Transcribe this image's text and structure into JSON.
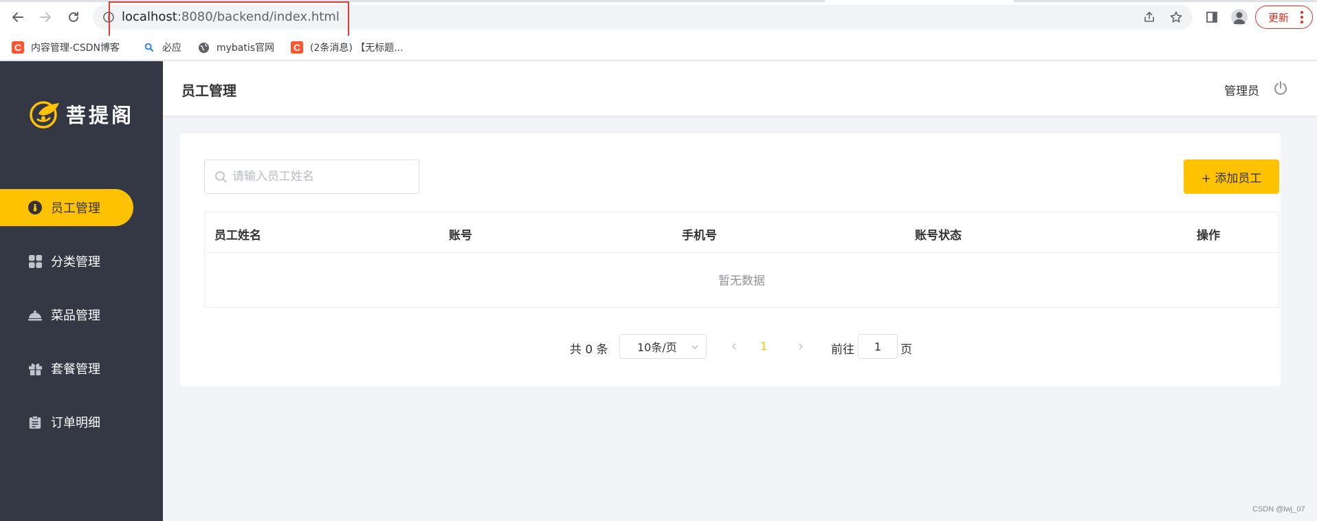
{
  "browser": {
    "url_host": "localhost",
    "url_rest": ":8080/backend/index.html",
    "update_label": "更新",
    "bookmarks": [
      {
        "label": "内容管理-CSDN博客",
        "icon": "csdn-icon"
      },
      {
        "label": "必应",
        "icon": "bing-search-icon"
      },
      {
        "label": "mybatis官网",
        "icon": "globe-icon"
      },
      {
        "label": "(2条消息) 【无标题...",
        "icon": "csdn-icon"
      }
    ],
    "csdn_glyph": "C"
  },
  "sidebar": {
    "logo_text": "菩提阁",
    "items": [
      {
        "label": "员工管理",
        "icon": "employee-icon",
        "active": true
      },
      {
        "label": "分类管理",
        "icon": "category-grid-icon",
        "active": false
      },
      {
        "label": "菜品管理",
        "icon": "dish-cloche-icon",
        "active": false
      },
      {
        "label": "套餐管理",
        "icon": "gift-icon",
        "active": false
      },
      {
        "label": "订单明细",
        "icon": "clipboard-icon",
        "active": false
      }
    ]
  },
  "header": {
    "title": "员工管理",
    "user": "管理员"
  },
  "toolbar": {
    "search_placeholder": "请输入员工姓名",
    "add_label": "+ 添加员工"
  },
  "table": {
    "columns": [
      "员工姓名",
      "账号",
      "手机号",
      "账号状态",
      "操作"
    ],
    "empty_text": "暂无数据"
  },
  "pagination": {
    "total_text": "共 0 条",
    "page_size": "10条/页",
    "current_page": "1",
    "goto_label": "前往",
    "goto_value": "1",
    "goto_suffix": "页"
  },
  "colors": {
    "accent": "#ffc200",
    "sidebar_bg": "#343744",
    "highlight_box": "#e53935"
  },
  "watermark": "CSDN @lwj_07"
}
